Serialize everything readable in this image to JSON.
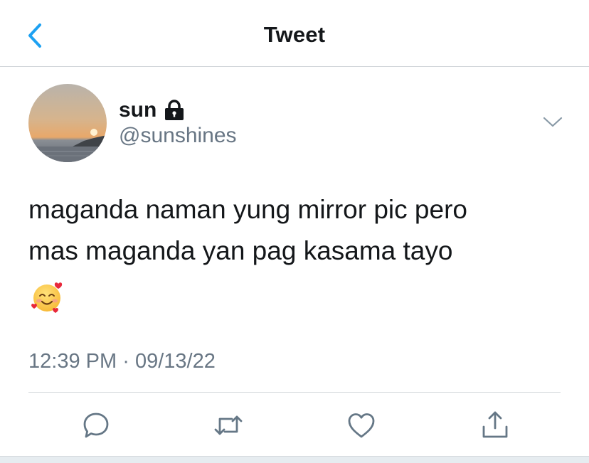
{
  "header": {
    "title": "Tweet",
    "back_icon": "chevron-left-icon"
  },
  "author": {
    "display_name": "sun",
    "handle": "@sunshines",
    "protected_icon": "lock-icon",
    "avatar": "sunset-over-sea-avatar"
  },
  "tweet": {
    "text_lines": [
      "maganda naman yung mirror pic pero",
      "mas maganda yan pag kasama tayo"
    ],
    "emoji": "smiling-face-with-hearts",
    "time": "12:39 PM",
    "separator": "·",
    "date": "09/13/22"
  },
  "actions": {
    "icons": [
      "reply-icon",
      "retweet-icon",
      "like-icon",
      "share-icon"
    ]
  },
  "colors": {
    "accent": "#1da1f2",
    "text_primary": "#14171a",
    "text_secondary": "#687684",
    "divider": "#d3d7db"
  }
}
